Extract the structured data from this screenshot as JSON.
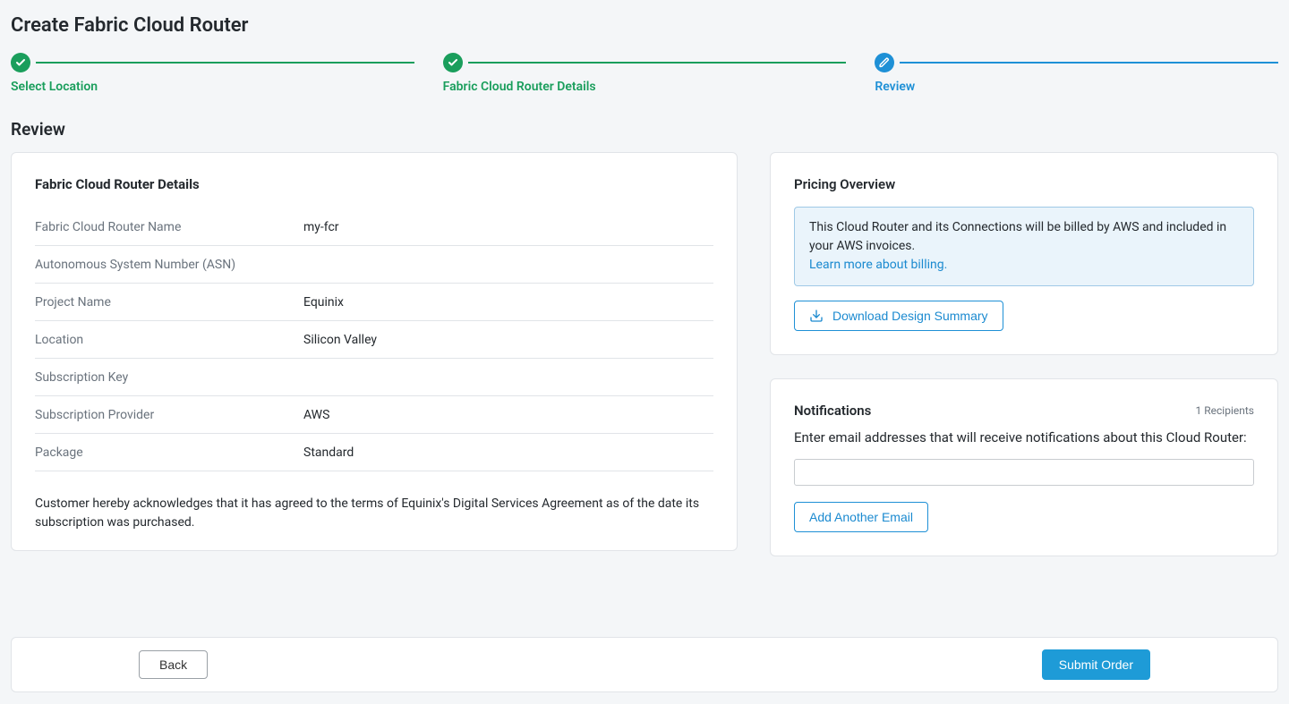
{
  "page": {
    "title": "Create Fabric Cloud Router",
    "section": "Review"
  },
  "stepper": {
    "steps": [
      {
        "label": "Select Location",
        "state": "done",
        "icon": "check"
      },
      {
        "label": "Fabric Cloud Router Details",
        "state": "done",
        "icon": "check"
      },
      {
        "label": "Review",
        "state": "current",
        "icon": "pencil"
      }
    ]
  },
  "details": {
    "heading": "Fabric Cloud Router Details",
    "rows": [
      {
        "key": "Fabric Cloud Router Name",
        "value": "my-fcr"
      },
      {
        "key": "Autonomous System Number (ASN)",
        "value": ""
      },
      {
        "key": "Project Name",
        "value": "Equinix"
      },
      {
        "key": "Location",
        "value": "Silicon Valley"
      },
      {
        "key": "Subscription Key",
        "value": ""
      },
      {
        "key": "Subscription Provider",
        "value": "AWS"
      },
      {
        "key": "Package",
        "value": "Standard"
      }
    ],
    "acknowledgement": "Customer hereby acknowledges that it has agreed to the terms of Equinix's Digital Services Agreement as of the date its subscription was purchased."
  },
  "pricing": {
    "heading": "Pricing Overview",
    "info_text": "This Cloud Router and its Connections will be billed by AWS and included in your AWS invoices.",
    "info_link": "Learn more about billing.",
    "download_label": "Download Design Summary"
  },
  "notifications": {
    "heading": "Notifications",
    "recipients_label": "1 Recipients",
    "description": "Enter email addresses that will receive notifications about this Cloud Router:",
    "email_value": "",
    "email_placeholder": "",
    "add_another_label": "Add Another Email"
  },
  "footer": {
    "back_label": "Back",
    "submit_label": "Submit Order"
  }
}
